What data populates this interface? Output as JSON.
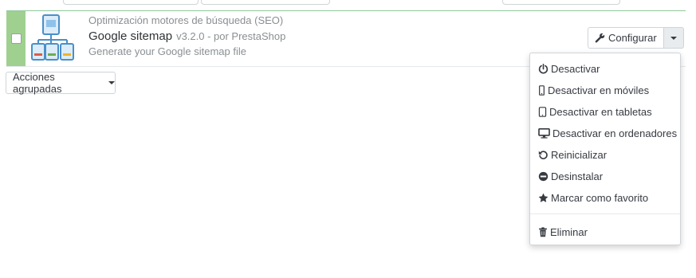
{
  "module": {
    "category": "Optimización motores de búsqueda (SEO)",
    "name": "Google sitemap",
    "version_author": "v3.2.0 - por PrestaShop",
    "description": "Generate your Google sitemap file",
    "status_color": "#9fd08f"
  },
  "actions": {
    "configure_label": "Configurar",
    "bulk_label": "Acciones agrupadas"
  },
  "dropdown_items": [
    {
      "label": "Desactivar",
      "icon": "power-icon"
    },
    {
      "label": "Desactivar en móviles",
      "icon": "mobile-icon"
    },
    {
      "label": "Desactivar en tabletas",
      "icon": "tablet-icon"
    },
    {
      "label": "Desactivar en ordenadores",
      "icon": "desktop-icon"
    },
    {
      "label": "Reinicializar",
      "icon": "undo-icon"
    },
    {
      "label": "Desinstalar",
      "icon": "minus-circle-icon"
    },
    {
      "label": "Marcar como favorito",
      "icon": "star-icon"
    },
    {
      "label": "Eliminar",
      "icon": "trash-icon"
    }
  ]
}
